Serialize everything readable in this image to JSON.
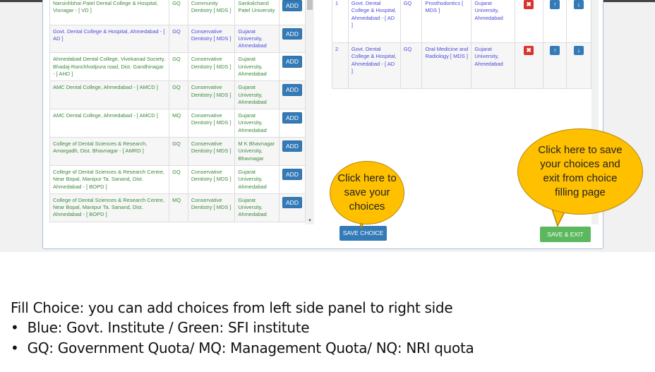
{
  "left_rows": [
    {
      "institute": "Narsinhbhai Patel Dental College & Hospital, Visnagar - [ VD ]",
      "quota": "GQ",
      "course": "Community Dentistry [ MDS ]",
      "university": "Sankalchand Patel University",
      "type": "sfi"
    },
    {
      "institute": "Govt. Dental College & Hospital, Ahmedabad - [ AD ]",
      "quota": "GQ",
      "course": "Conservative Dentistry [ MDS ]",
      "university": "Gujarat University, Ahmedabad",
      "type": "govt"
    },
    {
      "institute": "Ahmedabad Dental College, Vivekanad Society, Bhadaj-Ranchhodpura road, Dist. Gandhinagar - [ AHD ]",
      "quota": "GQ",
      "course": "Conservative Dentistry [ MDS ]",
      "university": "Gujarat University, Ahmedabad",
      "type": "sfi"
    },
    {
      "institute": "AMC Dental College, Ahmedabad - [ AMCD ]",
      "quota": "GQ",
      "course": "Conservative Dentistry [ MDS ]",
      "university": "Gujarat University, Ahmedabad",
      "type": "sfi"
    },
    {
      "institute": "AMC Dental College, Ahmedabad - [ AMCD ]",
      "quota": "MQ",
      "course": "Conservative Dentistry [ MDS ]",
      "university": "Gujarat University, Ahmedabad",
      "type": "sfi"
    },
    {
      "institute": "College of Dental Sciences & Research, Amargadh, Dist. Bhavnagar - [ AMRD ]",
      "quota": "GQ",
      "course": "Conservative Dentistry [ MDS ]",
      "university": "M K Bhavnagar University, Bhavnagar",
      "type": "sfi"
    },
    {
      "institute": "College of Dental Sciences & Research Centre, Near Bopal, Manipur Ta. Sanand, Dist. Ahmedabad - [ BOPD ]",
      "quota": "GQ",
      "course": "Conservative Dentistry [ MDS ]",
      "university": "Gujarat University, Ahmedabad",
      "type": "sfi"
    },
    {
      "institute": "College of Dental Sciences & Research Centre, Near Bopal, Manipur Ta. Sanand, Dist. Ahmedabad - [ BOPD ]",
      "quota": "MQ",
      "course": "Conservative Dentistry [ MDS ]",
      "university": "Gujarat University, Ahmedabad",
      "type": "sfi"
    }
  ],
  "add_label": "ADD",
  "right_rows": [
    {
      "no": "1",
      "institute": "Govt. Dental College & Hospital, Ahmedabad - [ AD ]",
      "quota": "GQ",
      "course": "Prosthodontics [ MDS ]",
      "university": "Gujarat University, Ahmedabad"
    },
    {
      "no": "2",
      "institute": "Govt. Dental College & Hospital, Ahmedabad - [ AD ]",
      "quota": "GQ",
      "course": "Oral Medicine and Radiology [ MDS ]",
      "university": "Gujarat University, Ahmedabad"
    }
  ],
  "buttons": {
    "save_choice": "SAVE CHOICE",
    "save_exit": "SAVE & EXIT"
  },
  "callouts": {
    "save": "Click here to save your choices",
    "save_exit": "Click here to save your choices and exit from  choice filling page"
  },
  "caption": {
    "title": "Fill Choice: you can add choices from left side panel to right side",
    "bullets": [
      "Blue: Govt. Institute / Green: SFI institute",
      "GQ: Government Quota/ MQ: Management Quota/ NQ: NRI quota"
    ]
  },
  "colors": {
    "govt": "#4b4bdc",
    "sfi": "#3b8a3b",
    "callout": "#ffc000",
    "save_choice": "#337ab7",
    "save_exit": "#5cb85c"
  }
}
